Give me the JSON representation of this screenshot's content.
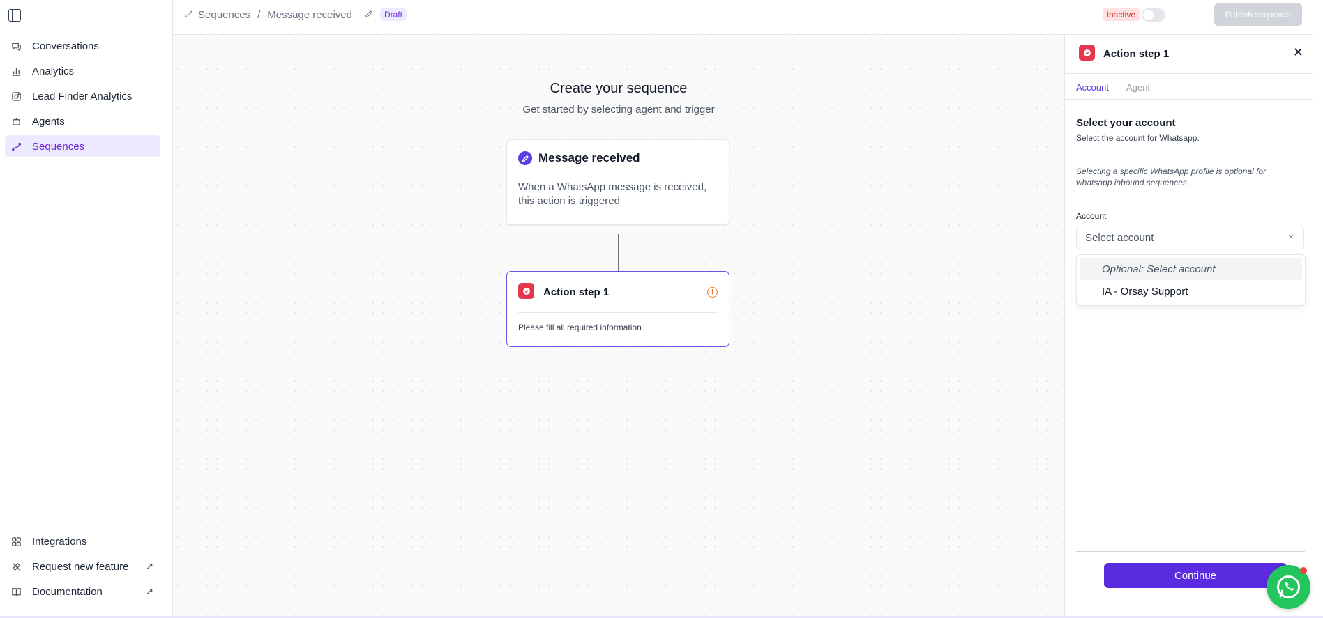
{
  "sidebar": {
    "items": [
      {
        "label": "Conversations",
        "icon": "chat-icon"
      },
      {
        "label": "Analytics",
        "icon": "bar-chart-icon"
      },
      {
        "label": "Lead Finder Analytics",
        "icon": "instagram-icon"
      },
      {
        "label": "Agents",
        "icon": "bot-icon"
      },
      {
        "label": "Sequences",
        "icon": "sequence-icon",
        "active": true
      }
    ],
    "bottom_items": [
      {
        "label": "Integrations",
        "icon": "grid-icon"
      },
      {
        "label": "Request new feature",
        "icon": "tools-icon"
      },
      {
        "label": "Documentation",
        "icon": "book-icon"
      }
    ]
  },
  "header": {
    "breadcrumb": {
      "root": "Sequences",
      "separator": "/",
      "current": "Message received"
    },
    "draft_badge": "Draft",
    "status_badge": "Inactive",
    "publish_label": "Publish sequence"
  },
  "canvas": {
    "title": "Create your sequence",
    "subtitle": "Get started by selecting agent and trigger",
    "trigger": {
      "title": "Message received",
      "description": "When a WhatsApp message is received, this action is triggered"
    },
    "action": {
      "title": "Action step 1",
      "description": "Please fill all required information"
    }
  },
  "panel": {
    "title": "Action step 1",
    "tabs": [
      "Account",
      "Agent"
    ],
    "section_title": "Select your account",
    "section_subtitle": "Select the account for Whatsapp.",
    "note": "Selecting a specific WhatsApp profile is optional for whatsapp inbound sequences.",
    "field_label": "Account",
    "select_placeholder": "Select account",
    "options": [
      "Optional: Select account",
      "IA - Orsay Support"
    ],
    "continue_label": "Continue"
  },
  "colors": {
    "accent": "#5b2be0",
    "active_nav_bg": "#ede9fe",
    "inactive_red": "#dc2626",
    "action_icon_red": "#e5384f",
    "whatsapp_green": "#22c55e"
  }
}
